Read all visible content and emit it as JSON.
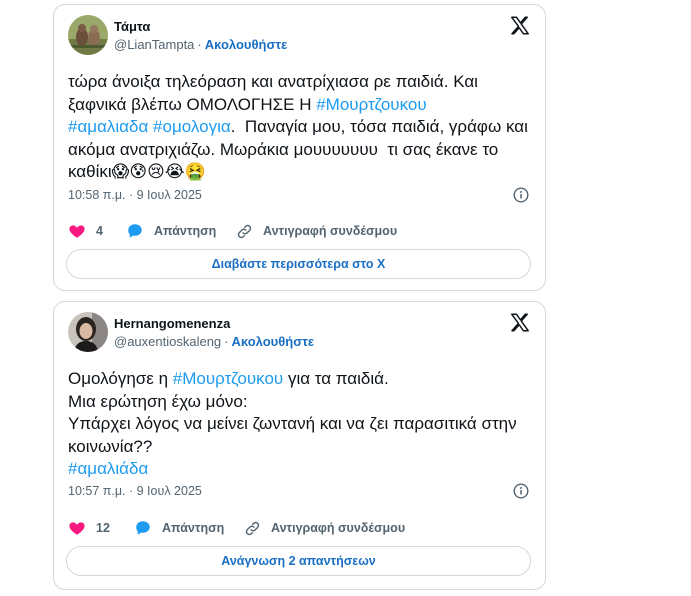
{
  "tweets": [
    {
      "display_name": "Τάμτα",
      "handle": "@LianTampta",
      "separator": "·",
      "follow_label": "Ακολουθήστε",
      "text_parts": [
        "τώρα άνοιξα τηλεόραση και ανατρίχιασα ρε παιδιά. Και ξαφνικά βλέπω ΟΜΟΛΟΓΗΣΕ Η ",
        "#Μουρτζουκου",
        "\n",
        "#αμαλιαδα",
        " ",
        "#ομολογια",
        ".  Παναγία μου, τόσα παιδιά, γράφω και ακόμα ανατριχιάζω. Μωράκια μουυυυυυυ  τι σας έκανε το καθίκι😱😰😢😭🤮"
      ],
      "timestamp": "10:58 π.μ. · 9 Ιουλ 2025",
      "like_count": "4",
      "reply_label": "Απάντηση",
      "copy_label": "Αντιγραφή συνδέσμου",
      "more_label": "Διαβάστε περισσότερα στο X",
      "like_color": "#f91880",
      "reply_color": "#1d9bf0"
    },
    {
      "display_name": "Hernangomenenza",
      "handle": "@auxentioskaleng",
      "separator": "·",
      "follow_label": "Ακολουθήστε",
      "text_parts": [
        "Ομολόγησε η ",
        "#Μουρτζουκου",
        " για τα παιδιά.\nΜια ερώτηση έχω μόνο:\nΥπάρχει λόγος να μείνει ζωντανή και να ζει παρασιτικά στην κοινωνία??\n",
        "#αμαλιάδα"
      ],
      "timestamp": "10:57 π.μ. · 9 Ιουλ 2025",
      "like_count": "12",
      "reply_label": "Απάντηση",
      "copy_label": "Αντιγραφή συνδέσμου",
      "more_label": "Ανάγνωση 2 απαντήσεων",
      "like_color": "#f91880",
      "reply_color": "#1d9bf0"
    }
  ],
  "icons": {
    "platform": "x-logo-icon",
    "info": "info-icon",
    "like": "heart-icon",
    "reply": "speech-bubble-icon",
    "copy": "link-icon"
  },
  "colors": {
    "hashtag": "#1d9bf0",
    "follow": "#1a6fc4",
    "muted": "#536471",
    "border": "#cfd9de"
  }
}
